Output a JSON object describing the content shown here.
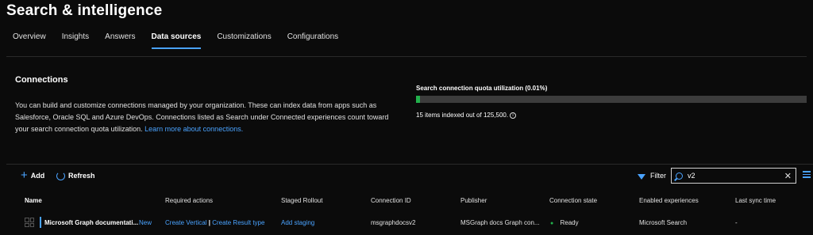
{
  "page": {
    "title": "Search & intelligence"
  },
  "tabs": [
    {
      "label": "Overview"
    },
    {
      "label": "Insights"
    },
    {
      "label": "Answers"
    },
    {
      "label": "Data sources",
      "active": true
    },
    {
      "label": "Customizations"
    },
    {
      "label": "Configurations"
    }
  ],
  "connections": {
    "title": "Connections",
    "description": "You can build and customize connections managed by your organization. These can index data from apps such as Salesforce, Oracle SQL and Azure DevOps. Connections listed as Search under Connected experiences count toward your search connection quota utilization.",
    "learn_more": "Learn more about connections."
  },
  "quota": {
    "title": "Search connection quota utilization (0.01%)",
    "fill_percent": 0.01,
    "text": "15 items indexed out of 125,500.",
    "fill_color": "#22b14c"
  },
  "toolbar": {
    "add_label": "Add",
    "refresh_label": "Refresh",
    "filter_label": "Filter",
    "search_value": "v2"
  },
  "table": {
    "headers": {
      "name": "Name",
      "required_actions": "Required actions",
      "staged_rollout": "Staged Rollout",
      "connection_id": "Connection ID",
      "publisher": "Publisher",
      "connection_state": "Connection state",
      "enabled_experiences": "Enabled experiences",
      "last_sync_time": "Last sync time"
    },
    "rows": [
      {
        "name": "Microsoft Graph documentati...",
        "badge": "New",
        "action_vertical": "Create Vertical",
        "action_separator": "|",
        "action_result_type": "Create Result type",
        "staged_rollout": "Add staging",
        "connection_id": "msgraphdocsv2",
        "publisher": "MSGraph docs Graph con...",
        "connection_state": "Ready",
        "enabled_experiences": "Microsoft Search",
        "last_sync_time": "-"
      }
    ]
  },
  "colors": {
    "accent": "#4aa3ff",
    "success": "#22b14c",
    "background": "#0b0b0b"
  }
}
